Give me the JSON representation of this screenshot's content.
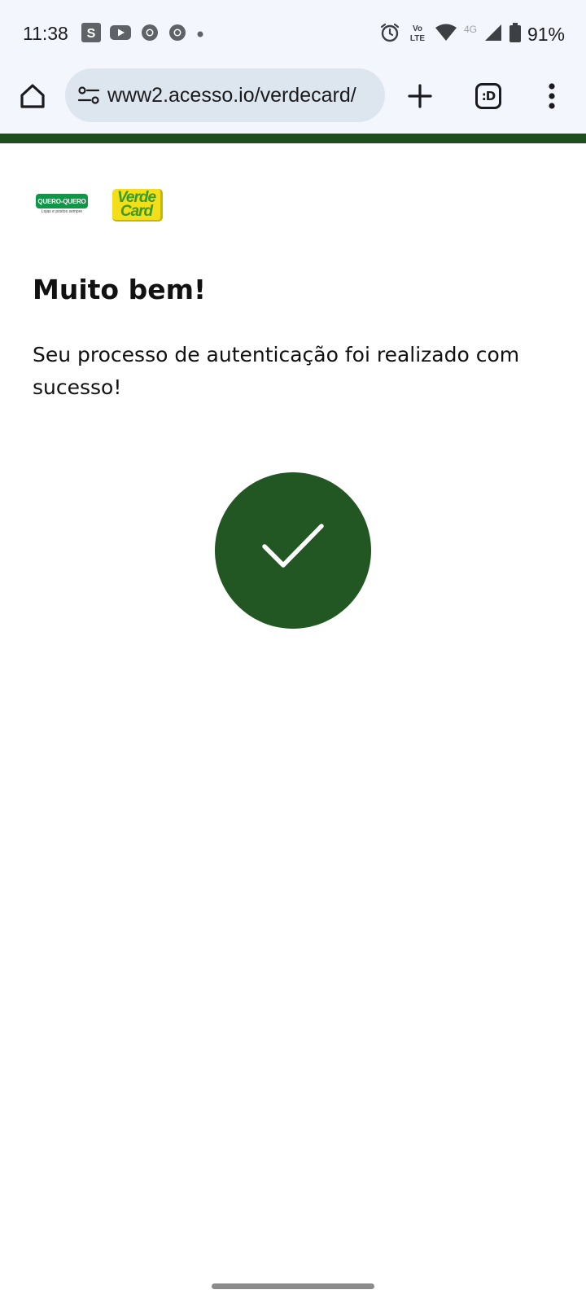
{
  "status_bar": {
    "time": "11:38",
    "notification_icons": [
      "s-app-icon",
      "youtube-icon",
      "chrome-icon",
      "chrome-icon",
      "dot-icon"
    ],
    "network_label": "4G",
    "battery": "91%"
  },
  "browser": {
    "url": "www2.acesso.io/verdecard/"
  },
  "page": {
    "logo_quero_quero": "QUERO-QUERO",
    "logo_quero_quero_tagline": "Lojas e postos sempre",
    "logo_verdecard_line1": "Verde",
    "logo_verdecard_line2": "Card",
    "title": "Muito bem!",
    "message": "Seu processo de autenticação foi realizado com sucesso!"
  },
  "colors": {
    "brand_green": "#225623",
    "header_bar": "#1e4d1e",
    "browser_chrome": "#f3f6fc",
    "url_bar": "#dde6ee"
  }
}
